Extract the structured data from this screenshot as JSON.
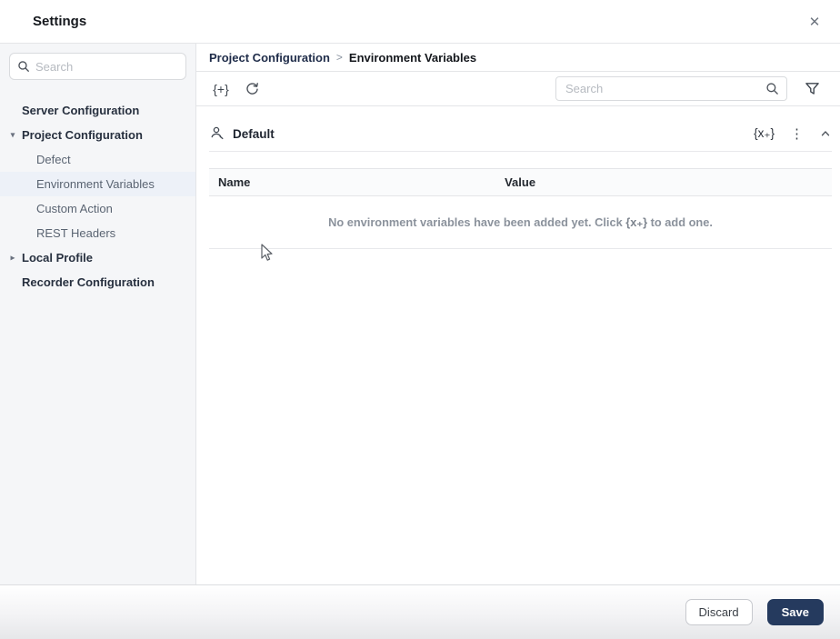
{
  "window": {
    "title": "Settings"
  },
  "icons": {
    "close": "✕",
    "caret_down": "▾",
    "caret_right": "▸",
    "add_profile": "{+}",
    "add_variable": "{x₊}",
    "kebab": "⋮"
  },
  "sidebar": {
    "search_placeholder": "Search",
    "items": [
      {
        "label": "Server Configuration"
      },
      {
        "label": "Project Configuration"
      },
      {
        "label": "Defect"
      },
      {
        "label": "Environment Variables"
      },
      {
        "label": "Custom Action"
      },
      {
        "label": "REST Headers"
      },
      {
        "label": "Local Profile"
      },
      {
        "label": "Recorder Configuration"
      }
    ]
  },
  "breadcrumb": {
    "parent": "Project Configuration",
    "separator": ">",
    "current": "Environment Variables"
  },
  "toolbar": {
    "search_placeholder": "Search"
  },
  "profile_section": {
    "name": "Default",
    "table": {
      "columns": {
        "name": "Name",
        "value": "Value"
      },
      "empty_before": "No environment variables have been added yet. Click ",
      "empty_after": " to add one."
    }
  },
  "footer": {
    "discard_label": "Discard",
    "save_label": "Save"
  },
  "colors": {
    "accent_navy": "#253a5e",
    "selected_item_bg": "#edf1f8",
    "sidebar_bg": "#f5f6f8"
  }
}
